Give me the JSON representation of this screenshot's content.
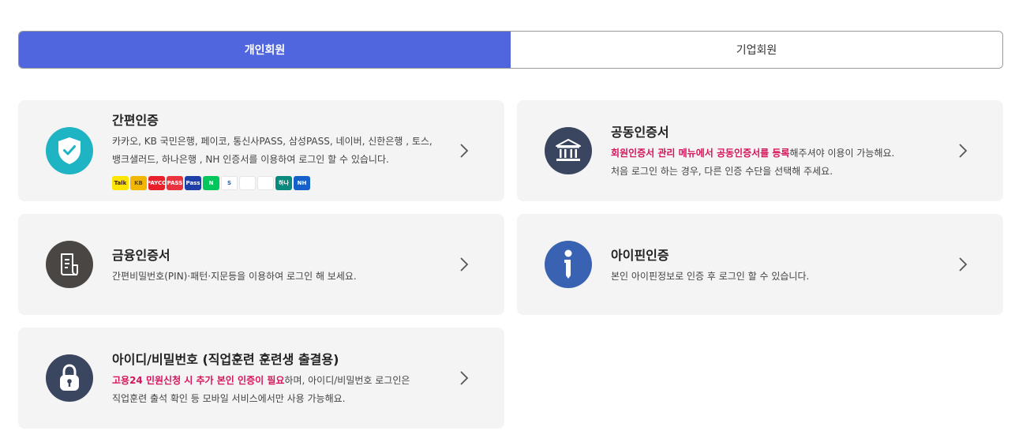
{
  "tabs": [
    {
      "label": "개인회원",
      "active": true
    },
    {
      "label": "기업회원",
      "active": false
    }
  ],
  "colors": {
    "accent": "#4f66de",
    "highlight": "#d6145c",
    "card_bg": "#f4f4f4",
    "icon_teal": "#1eb4c3",
    "icon_navy": "#3a4560",
    "icon_brown": "#4a4643",
    "icon_blue": "#3a62b2"
  },
  "cards": {
    "simple": {
      "title": "간편인증",
      "desc_line1": "카카오, KB 국민은행, 페이코, 통신사PASS, 삼성PASS, 네이버, 신한은행 , 토스,",
      "desc_line2": "뱅크샐러드, 하나은행 , NH 인증서를 이용하여 로그인 할 수 있습니다.",
      "icon": "shield-check-icon",
      "brands": [
        {
          "name": "kakao-icon",
          "text": "Talk",
          "bg": "#fee500",
          "fg": "#3a1d1d"
        },
        {
          "name": "kb-icon",
          "text": "KB",
          "bg": "#f2b705",
          "fg": "#5a4a1a"
        },
        {
          "name": "payco-icon",
          "text": "PAYCO",
          "bg": "#e8202a",
          "fg": "#ffffff"
        },
        {
          "name": "pass-icon",
          "text": "PASS",
          "bg": "#e9343f",
          "fg": "#ffffff"
        },
        {
          "name": "samsung-pass-icon",
          "text": "Pass",
          "bg": "#1f3fa8",
          "fg": "#ffffff"
        },
        {
          "name": "naver-icon",
          "text": "N",
          "bg": "#03c75a",
          "fg": "#ffffff"
        },
        {
          "name": "shinhan-icon",
          "text": "S",
          "bg": "#ffffff",
          "fg": "#1b5fc1"
        },
        {
          "name": "toss-icon",
          "text": "",
          "bg": "#ffffff",
          "fg": "#1b6ff5"
        },
        {
          "name": "banksalad-icon",
          "text": "",
          "bg": "#ffffff",
          "fg": "#11c18c"
        },
        {
          "name": "hana-icon",
          "text": "하나",
          "bg": "#0a8a7e",
          "fg": "#ffffff"
        },
        {
          "name": "nh-icon",
          "text": "NH",
          "bg": "#1660c9",
          "fg": "#ffffff"
        }
      ]
    },
    "joint": {
      "title": "공동인증서",
      "desc_hl": "회원인증서 관리 메뉴에서 공동인증서를 등록",
      "desc_line1_rest": "해주셔야 이용이 가능해요.",
      "desc_line2": "처음 로그인 하는 경우, 다른 인증 수단을 선택해 주세요.",
      "icon": "bank-icon"
    },
    "financial": {
      "title": "금융인증서",
      "desc_line1": "간편비밀번호(PIN)·패턴·지문등을 이용하여 로그인 해 보세요.",
      "icon": "document-icon"
    },
    "ipin": {
      "title": "아이핀인증",
      "desc_line1": "본인 아이핀정보로 인증 후 로그인 할 수 있습니다.",
      "icon": "info-icon"
    },
    "idpw": {
      "title": "아이디/비밀번호 (직업훈련 훈련생 출결용)",
      "desc_hl": "고용24 민원신청 시 추가 본인 인증이 필요",
      "desc_line1_rest": "하며, 아이디/비밀번호 로그인은",
      "desc_line2": "직업훈련 출석 확인 등 모바일 서비스에서만 사용 가능해요.",
      "icon": "lock-icon"
    }
  }
}
